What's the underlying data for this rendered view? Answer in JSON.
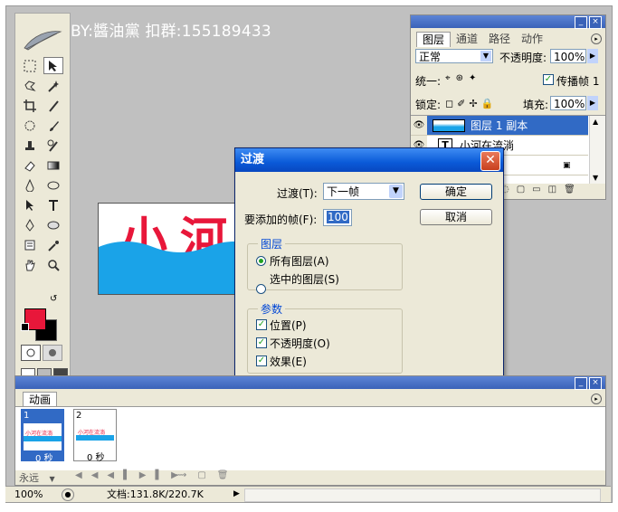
{
  "watermark": "BY:醬油黨 扣群:155189433",
  "layers_palette": {
    "tabs": [
      "图层",
      "通道",
      "路径",
      "动作"
    ],
    "blend_mode": "正常",
    "opacity_label": "不透明度:",
    "opacity_value": "100%",
    "unify_label": "统一:",
    "propagate_label": "传播帧 1",
    "lock_label": "锁定:",
    "fill_label": "填充:",
    "fill_value": "100%",
    "layers": [
      {
        "name": "图层 1 副本",
        "selected": true
      },
      {
        "name": "小河在流淌",
        "selected": false
      }
    ]
  },
  "dialog": {
    "title": "过渡",
    "transition_label": "过渡(T):",
    "transition_value": "下一帧",
    "frames_label": "要添加的帧(F):",
    "frames_value": "100",
    "ok_label": "确定",
    "cancel_label": "取消",
    "layers_group_label": "图层",
    "all_layers_label": "所有图层(A)",
    "selected_layers_label": "选中的图层(S)",
    "params_group_label": "参数",
    "position_label": "位置(P)",
    "opacity_label": "不透明度(O)",
    "effects_label": "效果(E)"
  },
  "canvas_text": "小河",
  "animation_palette": {
    "tab": "动画",
    "loop_label": "永远",
    "frames": [
      {
        "number": "1",
        "delay": "0 秒",
        "thumb_text": "小河在流淌"
      },
      {
        "number": "2",
        "delay": "0 秒",
        "thumb_text": "小河在流淌"
      }
    ]
  },
  "status_bar": {
    "zoom": "100%",
    "doc_info": "文档:131.8K/220.7K"
  },
  "colors": {
    "foreground": "#e8173a",
    "background": "#000000",
    "water": "#1aa3e8",
    "title_blue": "#0a5ad8"
  }
}
